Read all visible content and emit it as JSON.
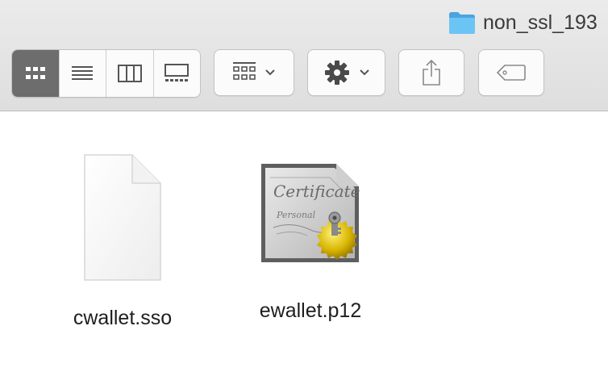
{
  "window": {
    "title": "non_ssl_193",
    "title_icon": "folder-icon"
  },
  "toolbar": {
    "view_modes": [
      {
        "name": "icon-view",
        "icon": "icon-grid-icon",
        "active": true
      },
      {
        "name": "list-view",
        "icon": "list-lines-icon",
        "active": false
      },
      {
        "name": "column-view",
        "icon": "columns-icon",
        "active": false
      },
      {
        "name": "gallery-view",
        "icon": "gallery-icon",
        "active": false
      }
    ],
    "group_button": {
      "icon": "group-grid-icon",
      "dropdown": "chevron-down-icon"
    },
    "action_button": {
      "icon": "gear-icon",
      "dropdown": "chevron-down-icon"
    },
    "share_button": {
      "icon": "share-icon"
    },
    "tags_button": {
      "icon": "tag-icon"
    }
  },
  "files": [
    {
      "name": "cwallet.sso",
      "icon": "generic-document-icon"
    },
    {
      "name": "ewallet.p12",
      "icon": "certificate-icon",
      "icon_text_1": "Certificate",
      "icon_text_2": "Personal"
    }
  ],
  "colors": {
    "toolbar_bg": "#e4e4e4",
    "active_segment": "#6d6d6d",
    "folder_blue": "#5ab4ee"
  }
}
